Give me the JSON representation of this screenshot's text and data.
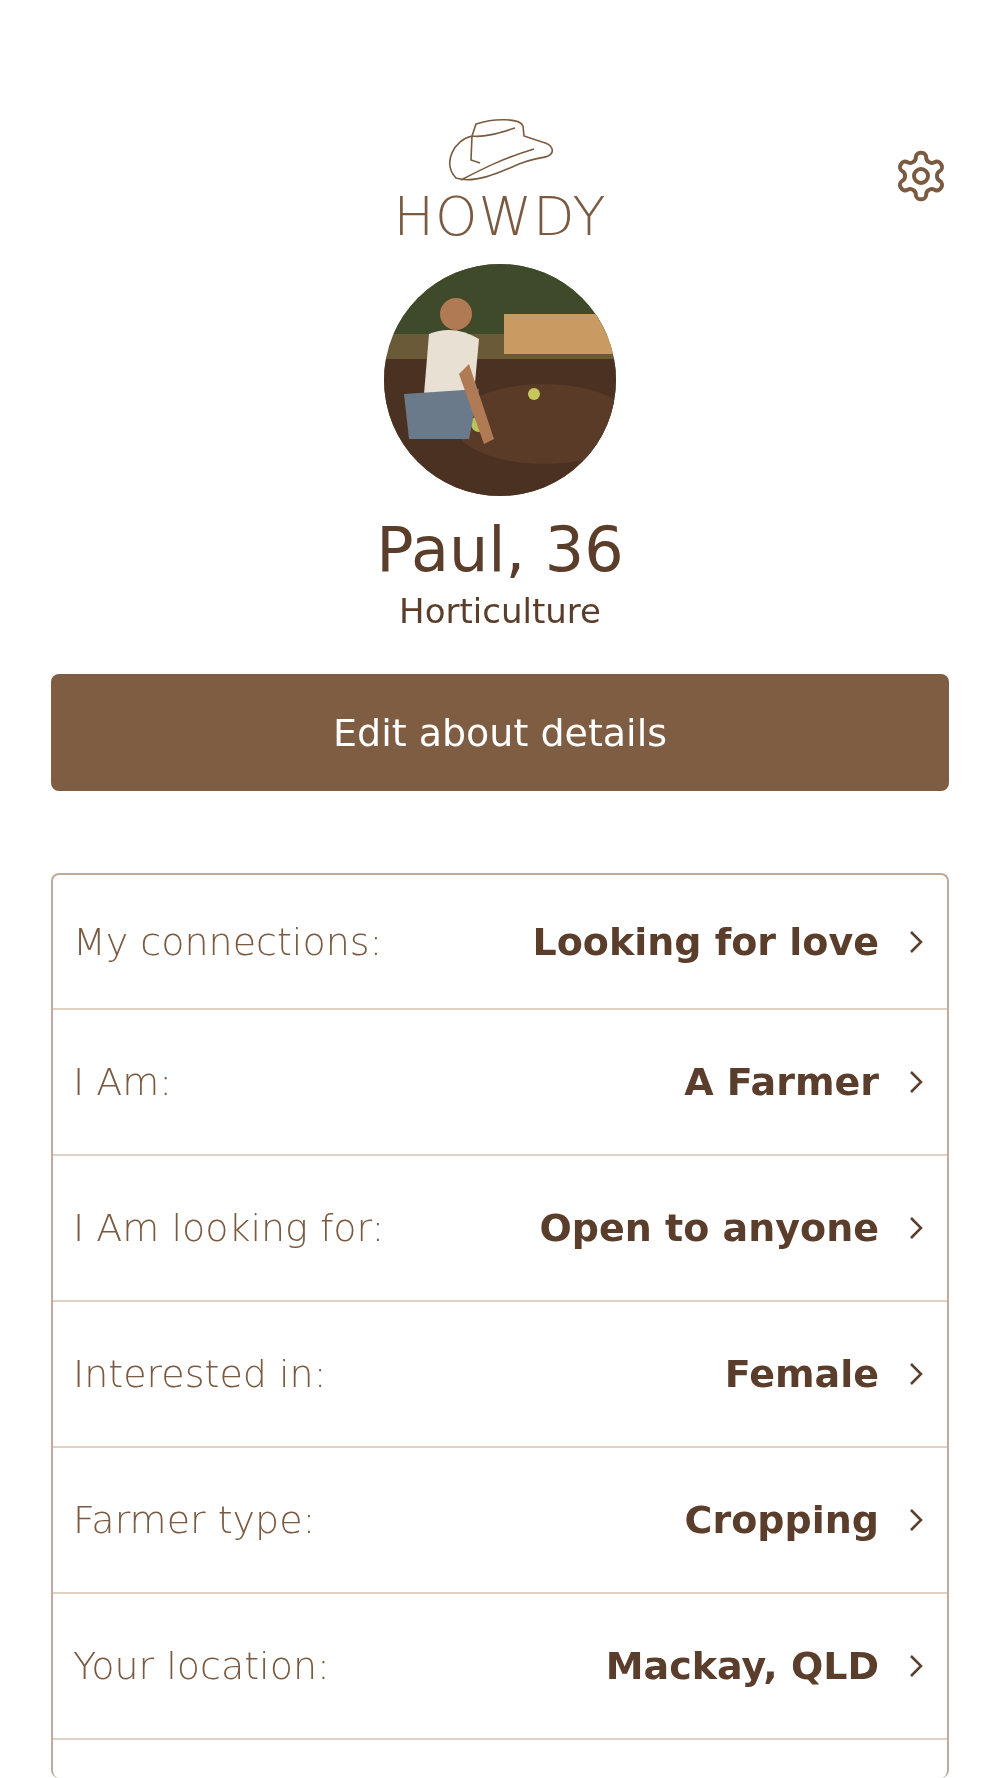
{
  "header": {
    "logo_text": "HOWDY"
  },
  "profile": {
    "name": "Paul, 36",
    "occupation": "Horticulture"
  },
  "edit_button": {
    "label": "Edit about details"
  },
  "details": [
    {
      "label": "My connections:",
      "value": "Looking for love"
    },
    {
      "label": "I Am:",
      "value": "A Farmer"
    },
    {
      "label": "I Am looking for:",
      "value": "Open to anyone"
    },
    {
      "label": "Interested in:",
      "value": "Female"
    },
    {
      "label": "Farmer type:",
      "value": "Cropping"
    },
    {
      "label": "Your location:",
      "value": "Mackay, QLD"
    }
  ]
}
